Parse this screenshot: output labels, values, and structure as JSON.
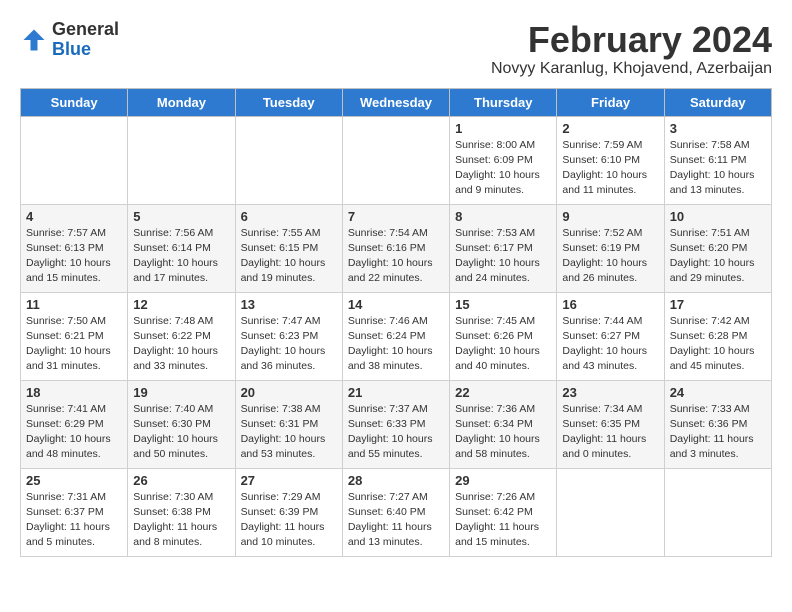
{
  "logo": {
    "general": "General",
    "blue": "Blue"
  },
  "title": "February 2024",
  "subtitle": "Novyy Karanlug, Khojavend, Azerbaijan",
  "days_of_week": [
    "Sunday",
    "Monday",
    "Tuesday",
    "Wednesday",
    "Thursday",
    "Friday",
    "Saturday"
  ],
  "weeks": [
    [
      {
        "day": "",
        "info": ""
      },
      {
        "day": "",
        "info": ""
      },
      {
        "day": "",
        "info": ""
      },
      {
        "day": "",
        "info": ""
      },
      {
        "day": "1",
        "info": "Sunrise: 8:00 AM\nSunset: 6:09 PM\nDaylight: 10 hours\nand 9 minutes."
      },
      {
        "day": "2",
        "info": "Sunrise: 7:59 AM\nSunset: 6:10 PM\nDaylight: 10 hours\nand 11 minutes."
      },
      {
        "day": "3",
        "info": "Sunrise: 7:58 AM\nSunset: 6:11 PM\nDaylight: 10 hours\nand 13 minutes."
      }
    ],
    [
      {
        "day": "4",
        "info": "Sunrise: 7:57 AM\nSunset: 6:13 PM\nDaylight: 10 hours\nand 15 minutes."
      },
      {
        "day": "5",
        "info": "Sunrise: 7:56 AM\nSunset: 6:14 PM\nDaylight: 10 hours\nand 17 minutes."
      },
      {
        "day": "6",
        "info": "Sunrise: 7:55 AM\nSunset: 6:15 PM\nDaylight: 10 hours\nand 19 minutes."
      },
      {
        "day": "7",
        "info": "Sunrise: 7:54 AM\nSunset: 6:16 PM\nDaylight: 10 hours\nand 22 minutes."
      },
      {
        "day": "8",
        "info": "Sunrise: 7:53 AM\nSunset: 6:17 PM\nDaylight: 10 hours\nand 24 minutes."
      },
      {
        "day": "9",
        "info": "Sunrise: 7:52 AM\nSunset: 6:19 PM\nDaylight: 10 hours\nand 26 minutes."
      },
      {
        "day": "10",
        "info": "Sunrise: 7:51 AM\nSunset: 6:20 PM\nDaylight: 10 hours\nand 29 minutes."
      }
    ],
    [
      {
        "day": "11",
        "info": "Sunrise: 7:50 AM\nSunset: 6:21 PM\nDaylight: 10 hours\nand 31 minutes."
      },
      {
        "day": "12",
        "info": "Sunrise: 7:48 AM\nSunset: 6:22 PM\nDaylight: 10 hours\nand 33 minutes."
      },
      {
        "day": "13",
        "info": "Sunrise: 7:47 AM\nSunset: 6:23 PM\nDaylight: 10 hours\nand 36 minutes."
      },
      {
        "day": "14",
        "info": "Sunrise: 7:46 AM\nSunset: 6:24 PM\nDaylight: 10 hours\nand 38 minutes."
      },
      {
        "day": "15",
        "info": "Sunrise: 7:45 AM\nSunset: 6:26 PM\nDaylight: 10 hours\nand 40 minutes."
      },
      {
        "day": "16",
        "info": "Sunrise: 7:44 AM\nSunset: 6:27 PM\nDaylight: 10 hours\nand 43 minutes."
      },
      {
        "day": "17",
        "info": "Sunrise: 7:42 AM\nSunset: 6:28 PM\nDaylight: 10 hours\nand 45 minutes."
      }
    ],
    [
      {
        "day": "18",
        "info": "Sunrise: 7:41 AM\nSunset: 6:29 PM\nDaylight: 10 hours\nand 48 minutes."
      },
      {
        "day": "19",
        "info": "Sunrise: 7:40 AM\nSunset: 6:30 PM\nDaylight: 10 hours\nand 50 minutes."
      },
      {
        "day": "20",
        "info": "Sunrise: 7:38 AM\nSunset: 6:31 PM\nDaylight: 10 hours\nand 53 minutes."
      },
      {
        "day": "21",
        "info": "Sunrise: 7:37 AM\nSunset: 6:33 PM\nDaylight: 10 hours\nand 55 minutes."
      },
      {
        "day": "22",
        "info": "Sunrise: 7:36 AM\nSunset: 6:34 PM\nDaylight: 10 hours\nand 58 minutes."
      },
      {
        "day": "23",
        "info": "Sunrise: 7:34 AM\nSunset: 6:35 PM\nDaylight: 11 hours\nand 0 minutes."
      },
      {
        "day": "24",
        "info": "Sunrise: 7:33 AM\nSunset: 6:36 PM\nDaylight: 11 hours\nand 3 minutes."
      }
    ],
    [
      {
        "day": "25",
        "info": "Sunrise: 7:31 AM\nSunset: 6:37 PM\nDaylight: 11 hours\nand 5 minutes."
      },
      {
        "day": "26",
        "info": "Sunrise: 7:30 AM\nSunset: 6:38 PM\nDaylight: 11 hours\nand 8 minutes."
      },
      {
        "day": "27",
        "info": "Sunrise: 7:29 AM\nSunset: 6:39 PM\nDaylight: 11 hours\nand 10 minutes."
      },
      {
        "day": "28",
        "info": "Sunrise: 7:27 AM\nSunset: 6:40 PM\nDaylight: 11 hours\nand 13 minutes."
      },
      {
        "day": "29",
        "info": "Sunrise: 7:26 AM\nSunset: 6:42 PM\nDaylight: 11 hours\nand 15 minutes."
      },
      {
        "day": "",
        "info": ""
      },
      {
        "day": "",
        "info": ""
      }
    ]
  ]
}
